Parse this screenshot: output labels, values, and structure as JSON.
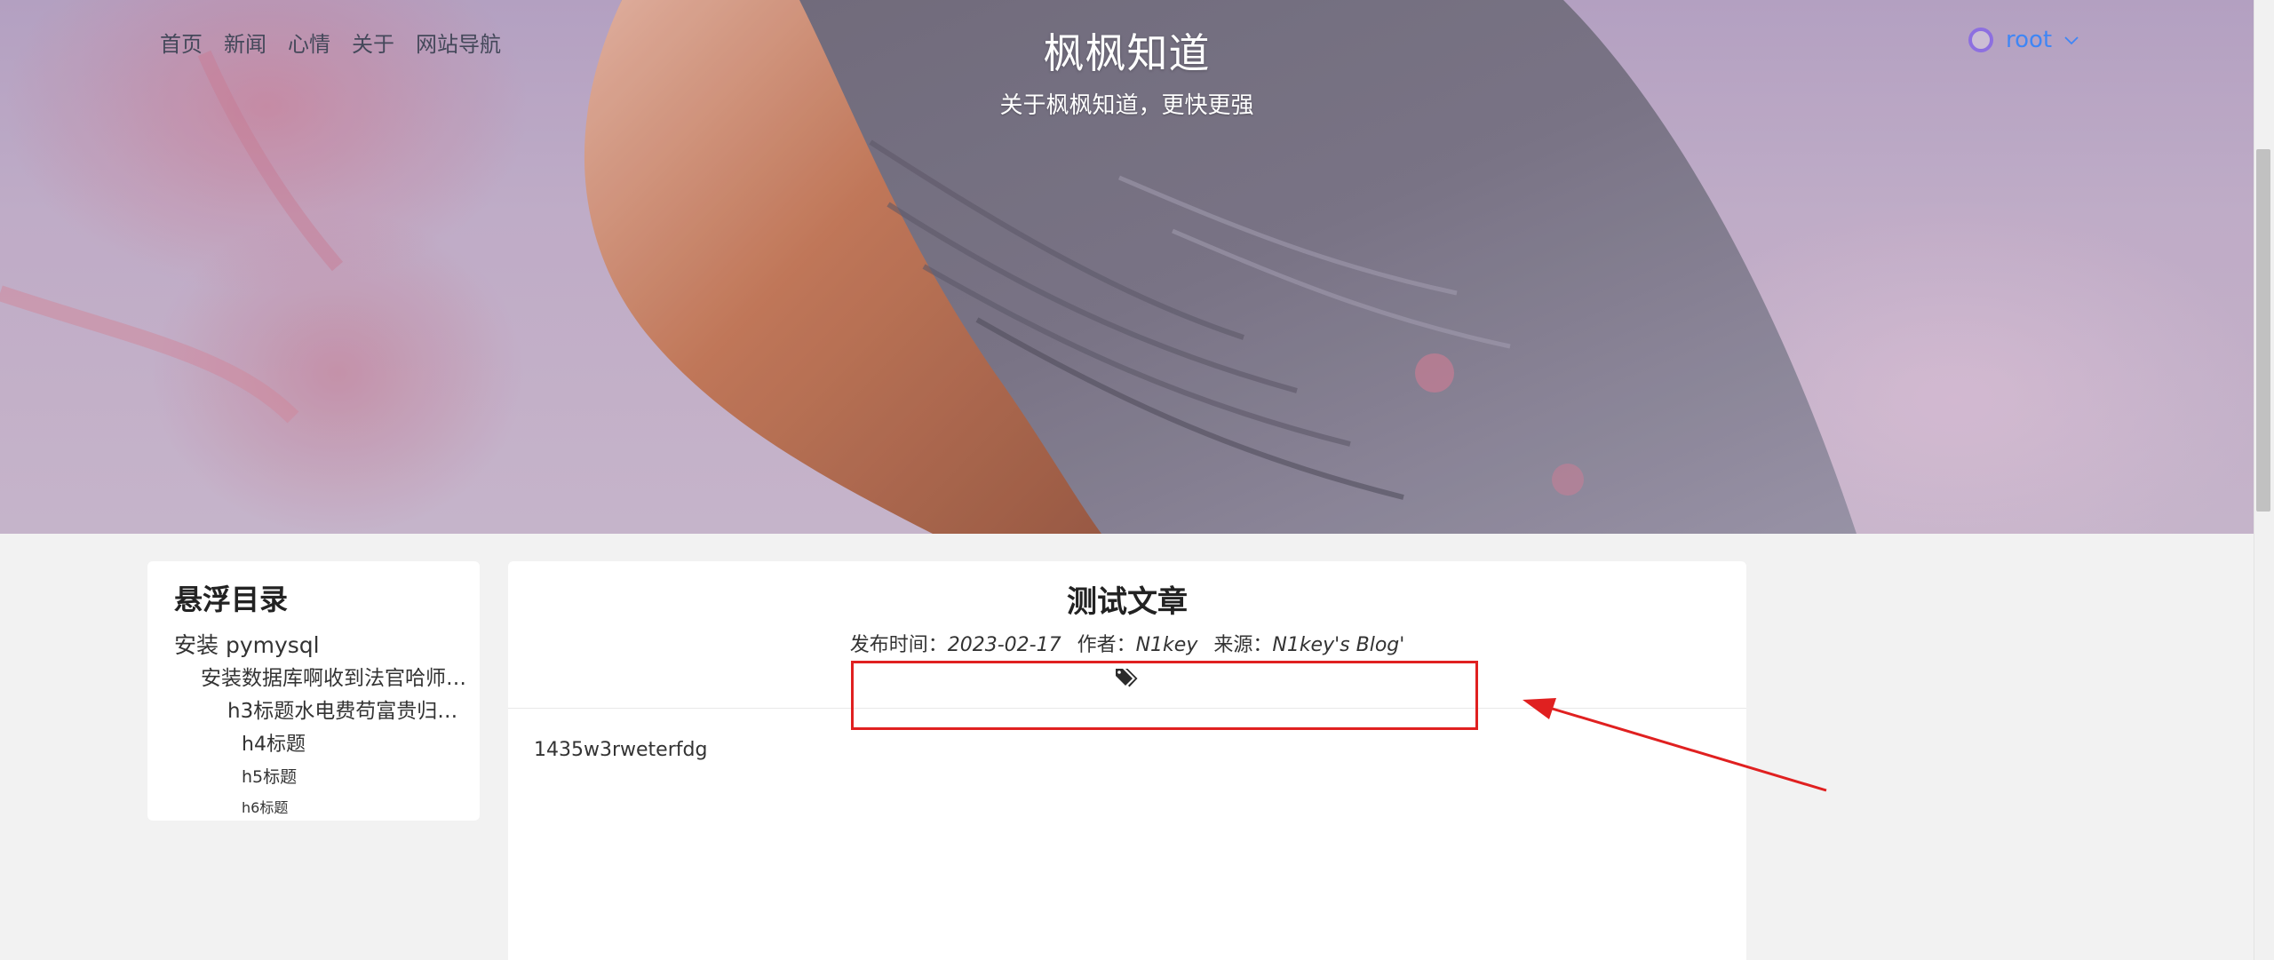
{
  "nav": {
    "items": [
      "首页",
      "新闻",
      "心情",
      "关于",
      "网站导航"
    ]
  },
  "site": {
    "title": "枫枫知道",
    "subtitle": "关于枫枫知道，更快更强"
  },
  "user": {
    "name": "root",
    "dropdown_icon": "chevron-down-icon"
  },
  "toc": {
    "heading": "悬浮目录",
    "items": [
      "安装 pymysql",
      "安装数据库啊收到法官哈师…",
      "h3标题水电费苟富贵归…",
      "h4标题",
      "h5标题",
      "h6标题"
    ]
  },
  "article": {
    "title": "测试文章",
    "meta": {
      "publish_label": "发布时间：",
      "publish_value": "2023-02-17",
      "author_label": "作者：",
      "author_value": "N1key",
      "source_label": "来源：",
      "source_value": "N1key's Blog'"
    },
    "tag_icon": "tags-icon",
    "body": "1435w3rweterfdg"
  },
  "colors": {
    "accent_blue": "#3f86f5",
    "annotation_red": "#e02020",
    "avatar_ring": "#8d6fe0",
    "page_bg": "#f2f2f2"
  }
}
